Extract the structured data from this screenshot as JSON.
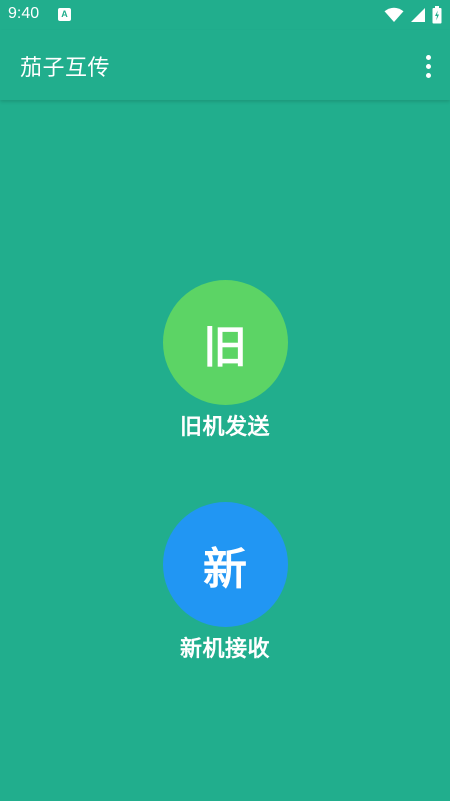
{
  "status_bar": {
    "time": "9:40",
    "notification_icon": "A"
  },
  "app_bar": {
    "title": "茄子互传",
    "menu_icon": "more-vert-icon"
  },
  "actions": {
    "old_device": {
      "glyph": "旧",
      "label": "旧机发送",
      "color": "#5CD465"
    },
    "new_device": {
      "glyph": "新",
      "label": "新机接收",
      "color": "#2196F3"
    }
  },
  "colors": {
    "background": "#21AE8D",
    "text": "#FFFFFF"
  }
}
